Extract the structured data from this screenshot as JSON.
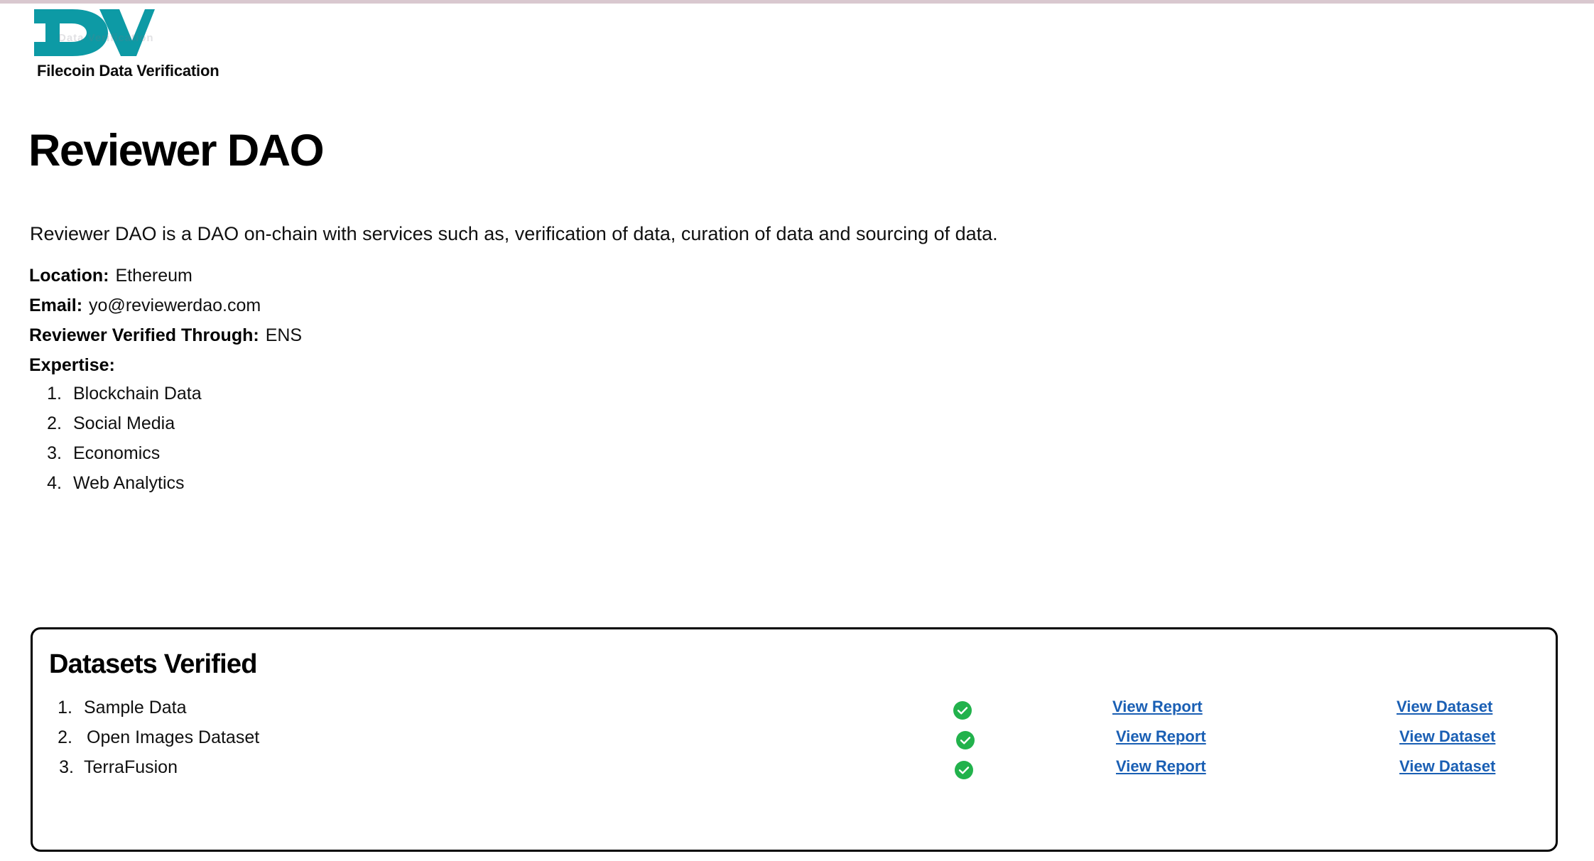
{
  "brand": {
    "logo_text": "DV",
    "logo_color": "#0d9aa5",
    "logo_watermark": "Data Verification",
    "subtitle": "Filecoin Data Verification"
  },
  "page_title": "Reviewer DAO",
  "description": "Reviewer DAO is a DAO on-chain with services such as, verification of data, curation of data and sourcing of data.",
  "meta": [
    {
      "label": "Location:",
      "value": "Ethereum"
    },
    {
      "label": "Email:",
      "value": "yo@reviewerdao.com"
    },
    {
      "label": "Reviewer Verified Through:",
      "value": "ENS"
    },
    {
      "label": "Expertise:",
      "value": ""
    }
  ],
  "expertise": [
    {
      "num": "1.",
      "label": "Blockchain Data"
    },
    {
      "num": "2.",
      "label": "Social Media"
    },
    {
      "num": "3.",
      "label": "Economics"
    },
    {
      "num": "4.",
      "label": "Web Analytics"
    }
  ],
  "datasets_card": {
    "title": "Datasets Verified",
    "verified_color": "#22b24c",
    "link_color": "#1a5fb4",
    "rows": [
      {
        "num": "1.",
        "name": "Sample Data",
        "verified": "verified",
        "report_link": "View Report",
        "dataset_link": "View Dataset"
      },
      {
        "num": "2.",
        "name": "Open Images Dataset",
        "verified": "verified",
        "report_link": "View Report",
        "dataset_link": "View Dataset"
      },
      {
        "num": "3.",
        "name": "TerraFusion",
        "verified": "verified",
        "report_link": "View Report",
        "dataset_link": "View Dataset"
      }
    ]
  }
}
